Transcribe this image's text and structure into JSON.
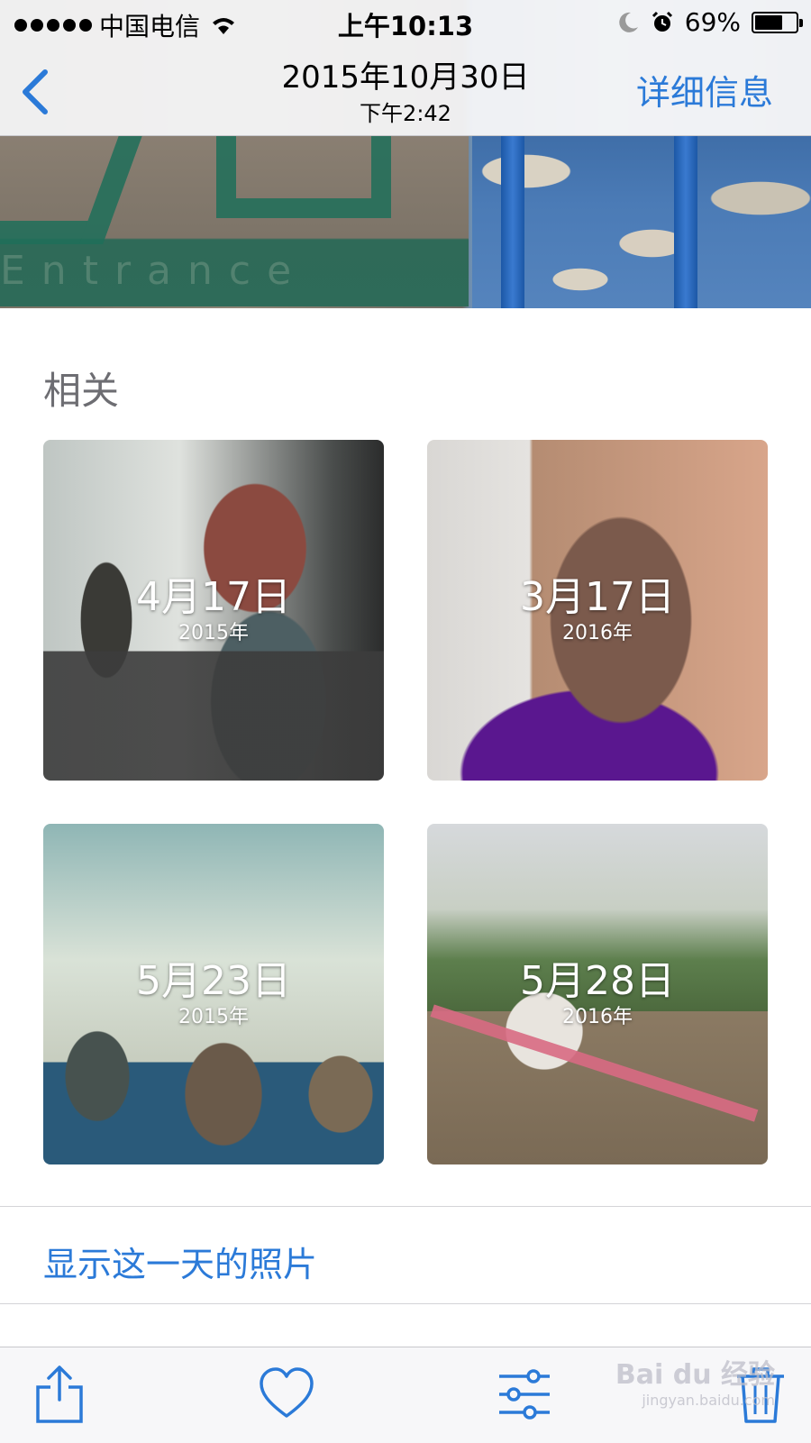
{
  "status_bar": {
    "carrier": "中国电信",
    "time": "上午10:13",
    "battery_percent": "69%"
  },
  "nav": {
    "title": "2015年10月30日",
    "subtitle": "下午2:42",
    "detail_label": "详细信息"
  },
  "hero": {
    "sign_text": "Entrance"
  },
  "related": {
    "label": "相关",
    "tiles": [
      {
        "date": "4月17日",
        "year": "2015年"
      },
      {
        "date": "3月17日",
        "year": "2016年"
      },
      {
        "date": "5月23日",
        "year": "2015年"
      },
      {
        "date": "5月28日",
        "year": "2016年"
      }
    ]
  },
  "show_day_label": "显示这一天的照片",
  "toolbar": {
    "icons": [
      "share-icon",
      "heart-icon",
      "adjust-icon",
      "trash-icon"
    ]
  },
  "watermark": {
    "brand": "Bai du 经验",
    "url": "jingyan.baidu.com"
  },
  "colors": {
    "accent": "#2b7ad8",
    "label_gray": "#6d6d72"
  }
}
